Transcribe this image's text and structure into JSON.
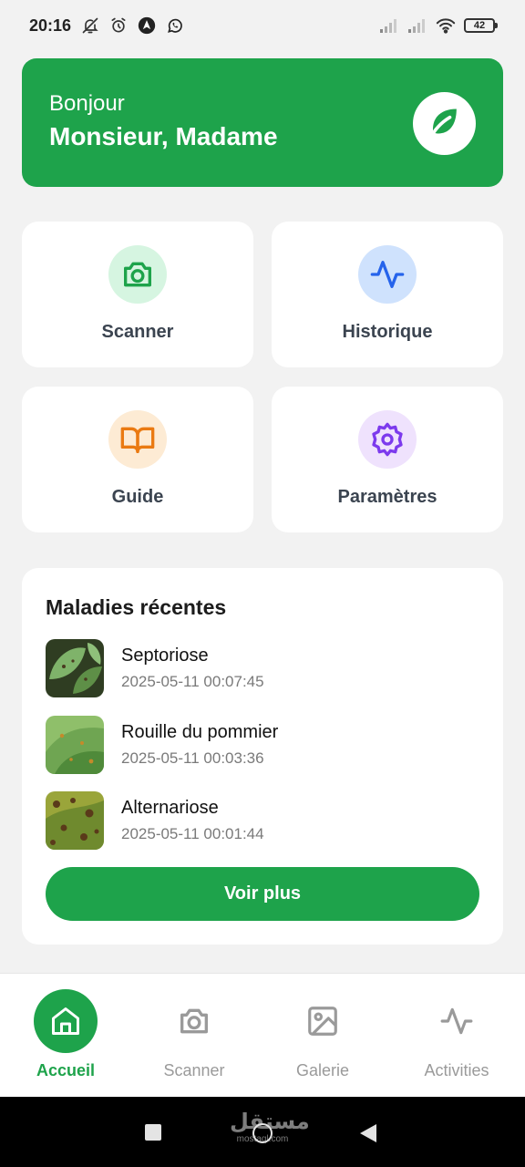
{
  "status_bar": {
    "time": "20:16",
    "left_icons": [
      "notifications-off-icon",
      "alarm-icon",
      "navigation-app-icon",
      "whatsapp-icon"
    ],
    "right_icons": [
      "signal-icon",
      "signal-icon",
      "wifi-icon"
    ],
    "battery": "42"
  },
  "greeting": {
    "hello": "Bonjour",
    "name": "Monsieur, Madame",
    "logo_icon": "leaf-icon"
  },
  "tiles": [
    {
      "label": "Scanner",
      "icon": "camera-icon",
      "color": "#1ea34b",
      "bg": "#d6f5e1"
    },
    {
      "label": "Historique",
      "icon": "activity-icon",
      "color": "#2563eb",
      "bg": "#cfe2fd"
    },
    {
      "label": "Guide",
      "icon": "book-icon",
      "color": "#ea7a12",
      "bg": "#fdebd4"
    },
    {
      "label": "Paramètres",
      "icon": "settings-icon",
      "color": "#7c3aed",
      "bg": "#efe2fd"
    }
  ],
  "recent": {
    "title": "Maladies récentes",
    "items": [
      {
        "name": "Septoriose",
        "date": "2025-05-11 00:07:45"
      },
      {
        "name": "Rouille du pommier",
        "date": "2025-05-11 00:03:36"
      },
      {
        "name": "Alternariose",
        "date": "2025-05-11 00:01:44"
      }
    ],
    "see_more": "Voir plus"
  },
  "bottom_nav": [
    {
      "label": "Accueil",
      "icon": "home-icon",
      "active": true
    },
    {
      "label": "Scanner",
      "icon": "camera-icon",
      "active": false
    },
    {
      "label": "Galerie",
      "icon": "image-icon",
      "active": false
    },
    {
      "label": "Activities",
      "icon": "activity-icon",
      "active": false
    }
  ],
  "watermark": {
    "logo": "مستقل",
    "domain": "mostaql.com"
  },
  "colors": {
    "primary": "#1ea34b",
    "background": "#f2f2f2",
    "card": "#ffffff"
  }
}
